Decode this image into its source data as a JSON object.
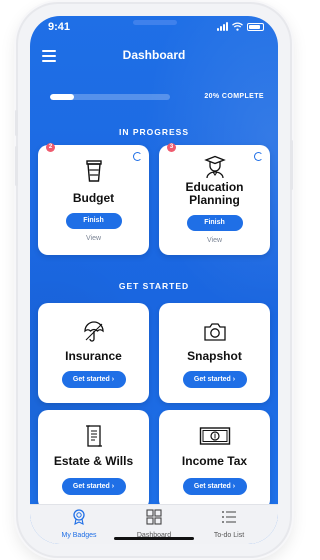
{
  "status_bar": {
    "time": "9:41"
  },
  "header": {
    "title": "Dashboard",
    "menu_icon": "hamburger-icon"
  },
  "progress": {
    "value_percent": 20,
    "label": "20% COMPLETE"
  },
  "sections": {
    "in_progress": "IN PROGRESS",
    "get_started": "GET STARTED"
  },
  "in_progress_cards": [
    {
      "name": "Budget",
      "icon": "coffee-cup-icon",
      "badge": "2",
      "button": "Finish",
      "link": "View"
    },
    {
      "name": "Education Planning",
      "icon": "graduate-icon",
      "badge": "3",
      "button": "Finish",
      "link": "View"
    }
  ],
  "get_started_cards": [
    {
      "name": "Insurance",
      "icon": "umbrella-icon",
      "button": "Get started  ›"
    },
    {
      "name": "Snapshot",
      "icon": "camera-icon",
      "button": "Get started  ›"
    },
    {
      "name": "Estate & Wills",
      "icon": "document-icon",
      "button": "Get started  ›"
    },
    {
      "name": "Income Tax",
      "icon": "cash-icon",
      "button": "Get started  ›"
    }
  ],
  "tabs": [
    {
      "label": "My Badges",
      "icon": "badge-icon",
      "active": true
    },
    {
      "label": "Dashboard",
      "icon": "dashboard-icon",
      "active": false
    },
    {
      "label": "To-do List",
      "icon": "todo-list-icon",
      "active": false
    }
  ],
  "colors": {
    "primary": "#1f6fe6",
    "badge": "#ef5b6e",
    "card": "#ffffff",
    "tabbar": "#f1f2f5"
  }
}
